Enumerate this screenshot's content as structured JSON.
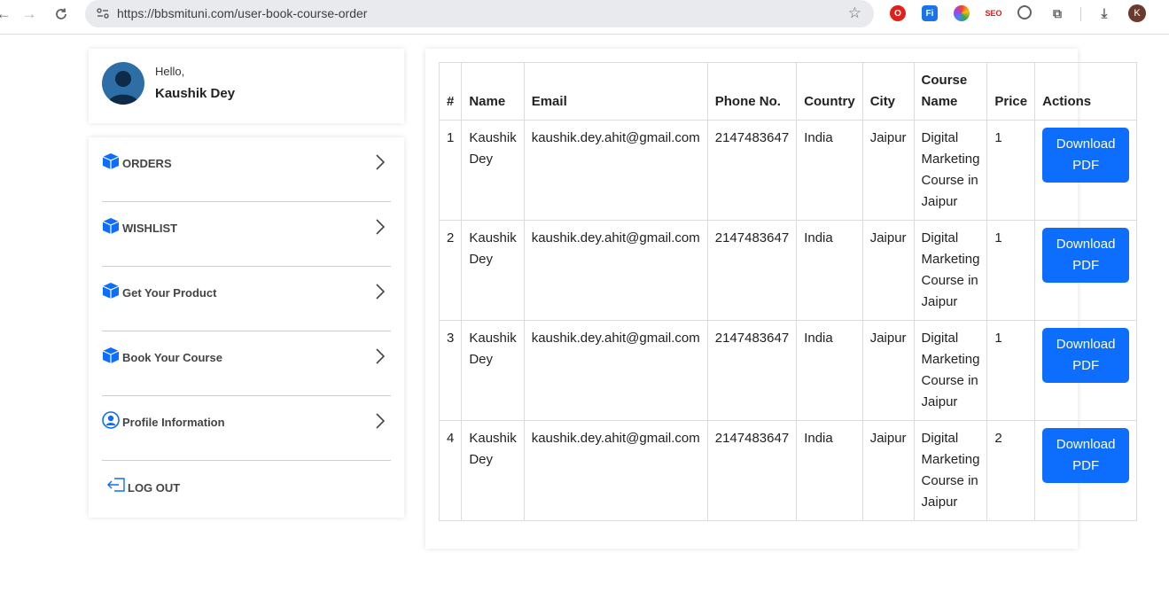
{
  "browser": {
    "url": "https://bbsmituni.com/user-book-course-order",
    "profile_initial": "K",
    "extensions": [
      {
        "name": "opera-icon",
        "color": "#e0201b"
      },
      {
        "name": "fi-extension-icon",
        "color": "#1a73e8"
      },
      {
        "name": "color-wheel-icon",
        "color": "#34a853"
      },
      {
        "name": "seo-extension-icon",
        "color": "#c5221f"
      },
      {
        "name": "grammarly-icon",
        "color": "#5f6368"
      },
      {
        "name": "puzzle-extensions-icon",
        "color": "#5f6368"
      }
    ]
  },
  "user": {
    "greeting": "Hello,",
    "name": "Kaushik Dey"
  },
  "menu": {
    "items": [
      {
        "label": "ORDERS",
        "icon": "box-icon"
      },
      {
        "label": "WISHLIST",
        "icon": "box-icon"
      },
      {
        "label": "Get Your Product",
        "icon": "box-icon"
      },
      {
        "label": "Book Your Course",
        "icon": "box-icon"
      },
      {
        "label": "Profile Information",
        "icon": "user-circle-icon"
      }
    ],
    "logout": "LOG OUT"
  },
  "table": {
    "headers": [
      "#",
      "Name",
      "Email",
      "Phone No.",
      "Country",
      "City",
      "Course Name",
      "Price",
      "Actions"
    ],
    "rows": [
      {
        "num": "1",
        "name": "Kaushik Dey",
        "email": "kaushik.dey.ahit@gmail.com",
        "phone": "2147483647",
        "country": "India",
        "city": "Jaipur",
        "course": "Digital Marketing Course in Jaipur",
        "price": "1",
        "action": "Download PDF"
      },
      {
        "num": "2",
        "name": "Kaushik Dey",
        "email": "kaushik.dey.ahit@gmail.com",
        "phone": "2147483647",
        "country": "India",
        "city": "Jaipur",
        "course": "Digital Marketing Course in Jaipur",
        "price": "1",
        "action": "Download PDF"
      },
      {
        "num": "3",
        "name": "Kaushik Dey",
        "email": "kaushik.dey.ahit@gmail.com",
        "phone": "2147483647",
        "country": "India",
        "city": "Jaipur",
        "course": "Digital Marketing Course in Jaipur",
        "price": "1",
        "action": "Download PDF"
      },
      {
        "num": "4",
        "name": "Kaushik Dey",
        "email": "kaushik.dey.ahit@gmail.com",
        "phone": "2147483647",
        "country": "India",
        "city": "Jaipur",
        "course": "Digital Marketing Course in Jaipur",
        "price": "2",
        "action": "Download PDF"
      }
    ]
  },
  "colors": {
    "accent": "#0d6efd",
    "avatar": "#2c6ea5"
  }
}
